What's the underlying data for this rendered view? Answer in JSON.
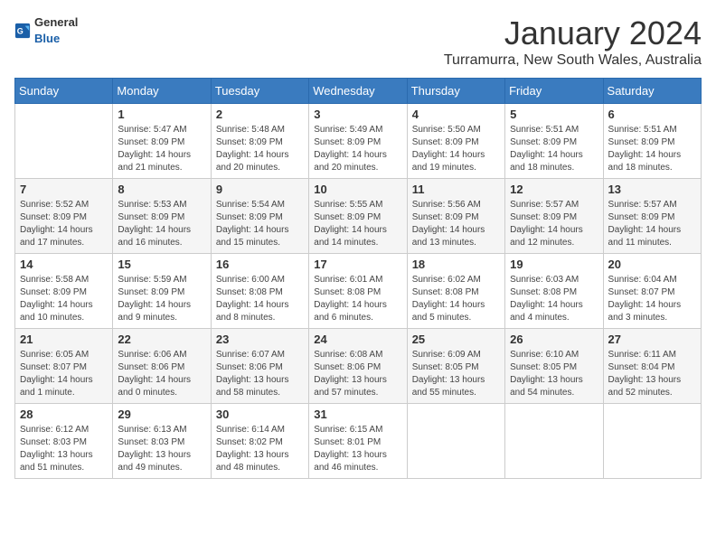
{
  "app": {
    "name_general": "General",
    "name_blue": "Blue"
  },
  "title": "January 2024",
  "location": "Turramurra, New South Wales, Australia",
  "headers": [
    "Sunday",
    "Monday",
    "Tuesday",
    "Wednesday",
    "Thursday",
    "Friday",
    "Saturday"
  ],
  "weeks": [
    [
      {
        "day": "",
        "info": ""
      },
      {
        "day": "1",
        "info": "Sunrise: 5:47 AM\nSunset: 8:09 PM\nDaylight: 14 hours\nand 21 minutes."
      },
      {
        "day": "2",
        "info": "Sunrise: 5:48 AM\nSunset: 8:09 PM\nDaylight: 14 hours\nand 20 minutes."
      },
      {
        "day": "3",
        "info": "Sunrise: 5:49 AM\nSunset: 8:09 PM\nDaylight: 14 hours\nand 20 minutes."
      },
      {
        "day": "4",
        "info": "Sunrise: 5:50 AM\nSunset: 8:09 PM\nDaylight: 14 hours\nand 19 minutes."
      },
      {
        "day": "5",
        "info": "Sunrise: 5:51 AM\nSunset: 8:09 PM\nDaylight: 14 hours\nand 18 minutes."
      },
      {
        "day": "6",
        "info": "Sunrise: 5:51 AM\nSunset: 8:09 PM\nDaylight: 14 hours\nand 18 minutes."
      }
    ],
    [
      {
        "day": "7",
        "info": "Sunrise: 5:52 AM\nSunset: 8:09 PM\nDaylight: 14 hours\nand 17 minutes."
      },
      {
        "day": "8",
        "info": "Sunrise: 5:53 AM\nSunset: 8:09 PM\nDaylight: 14 hours\nand 16 minutes."
      },
      {
        "day": "9",
        "info": "Sunrise: 5:54 AM\nSunset: 8:09 PM\nDaylight: 14 hours\nand 15 minutes."
      },
      {
        "day": "10",
        "info": "Sunrise: 5:55 AM\nSunset: 8:09 PM\nDaylight: 14 hours\nand 14 minutes."
      },
      {
        "day": "11",
        "info": "Sunrise: 5:56 AM\nSunset: 8:09 PM\nDaylight: 14 hours\nand 13 minutes."
      },
      {
        "day": "12",
        "info": "Sunrise: 5:57 AM\nSunset: 8:09 PM\nDaylight: 14 hours\nand 12 minutes."
      },
      {
        "day": "13",
        "info": "Sunrise: 5:57 AM\nSunset: 8:09 PM\nDaylight: 14 hours\nand 11 minutes."
      }
    ],
    [
      {
        "day": "14",
        "info": "Sunrise: 5:58 AM\nSunset: 8:09 PM\nDaylight: 14 hours\nand 10 minutes."
      },
      {
        "day": "15",
        "info": "Sunrise: 5:59 AM\nSunset: 8:09 PM\nDaylight: 14 hours\nand 9 minutes."
      },
      {
        "day": "16",
        "info": "Sunrise: 6:00 AM\nSunset: 8:08 PM\nDaylight: 14 hours\nand 8 minutes."
      },
      {
        "day": "17",
        "info": "Sunrise: 6:01 AM\nSunset: 8:08 PM\nDaylight: 14 hours\nand 6 minutes."
      },
      {
        "day": "18",
        "info": "Sunrise: 6:02 AM\nSunset: 8:08 PM\nDaylight: 14 hours\nand 5 minutes."
      },
      {
        "day": "19",
        "info": "Sunrise: 6:03 AM\nSunset: 8:08 PM\nDaylight: 14 hours\nand 4 minutes."
      },
      {
        "day": "20",
        "info": "Sunrise: 6:04 AM\nSunset: 8:07 PM\nDaylight: 14 hours\nand 3 minutes."
      }
    ],
    [
      {
        "day": "21",
        "info": "Sunrise: 6:05 AM\nSunset: 8:07 PM\nDaylight: 14 hours\nand 1 minute."
      },
      {
        "day": "22",
        "info": "Sunrise: 6:06 AM\nSunset: 8:06 PM\nDaylight: 14 hours\nand 0 minutes."
      },
      {
        "day": "23",
        "info": "Sunrise: 6:07 AM\nSunset: 8:06 PM\nDaylight: 13 hours\nand 58 minutes."
      },
      {
        "day": "24",
        "info": "Sunrise: 6:08 AM\nSunset: 8:06 PM\nDaylight: 13 hours\nand 57 minutes."
      },
      {
        "day": "25",
        "info": "Sunrise: 6:09 AM\nSunset: 8:05 PM\nDaylight: 13 hours\nand 55 minutes."
      },
      {
        "day": "26",
        "info": "Sunrise: 6:10 AM\nSunset: 8:05 PM\nDaylight: 13 hours\nand 54 minutes."
      },
      {
        "day": "27",
        "info": "Sunrise: 6:11 AM\nSunset: 8:04 PM\nDaylight: 13 hours\nand 52 minutes."
      }
    ],
    [
      {
        "day": "28",
        "info": "Sunrise: 6:12 AM\nSunset: 8:03 PM\nDaylight: 13 hours\nand 51 minutes."
      },
      {
        "day": "29",
        "info": "Sunrise: 6:13 AM\nSunset: 8:03 PM\nDaylight: 13 hours\nand 49 minutes."
      },
      {
        "day": "30",
        "info": "Sunrise: 6:14 AM\nSunset: 8:02 PM\nDaylight: 13 hours\nand 48 minutes."
      },
      {
        "day": "31",
        "info": "Sunrise: 6:15 AM\nSunset: 8:01 PM\nDaylight: 13 hours\nand 46 minutes."
      },
      {
        "day": "",
        "info": ""
      },
      {
        "day": "",
        "info": ""
      },
      {
        "day": "",
        "info": ""
      }
    ]
  ]
}
